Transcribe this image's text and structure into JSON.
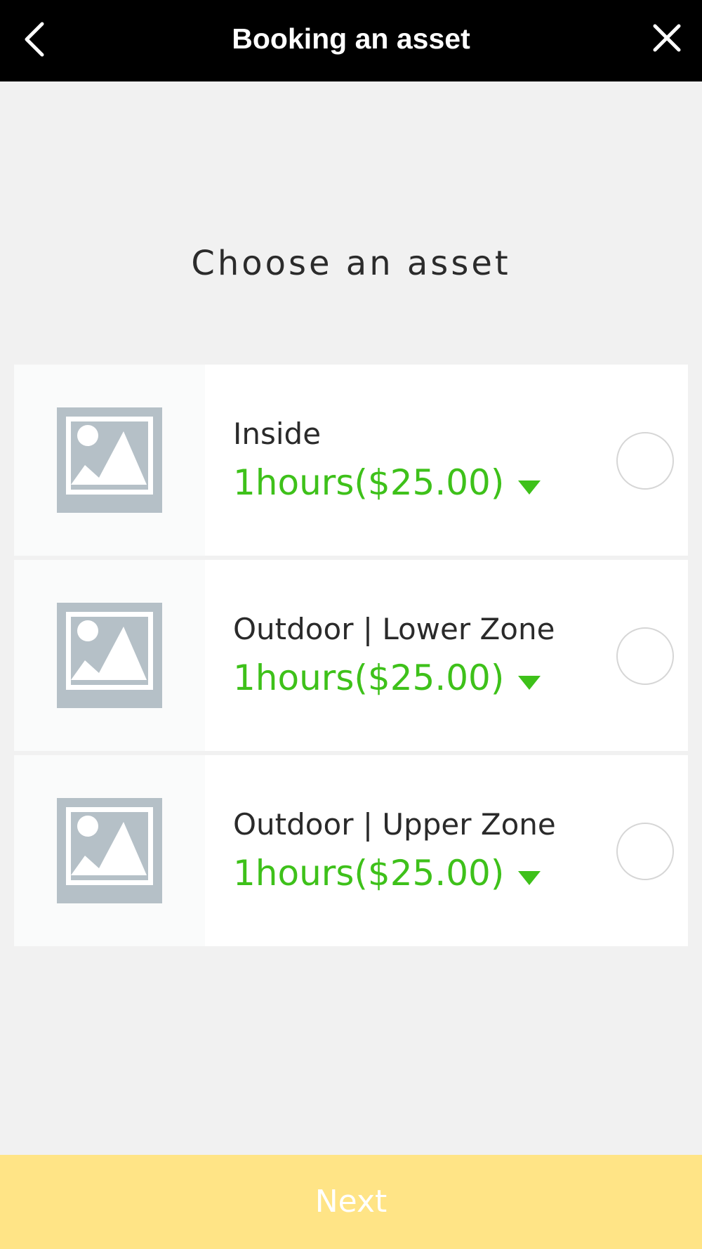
{
  "header": {
    "title": "Booking an asset",
    "back_icon": "chevron-left-icon",
    "close_icon": "close-icon"
  },
  "main": {
    "title": "Choose an asset",
    "assets": [
      {
        "name": "Inside",
        "duration": "1hours($25.00)",
        "selected": false
      },
      {
        "name": "Outdoor | Lower Zone",
        "duration": "1hours($25.00)",
        "selected": false
      },
      {
        "name": "Outdoor | Upper Zone",
        "duration": "1hours($25.00)",
        "selected": false
      }
    ]
  },
  "footer": {
    "next_label": "Next"
  },
  "colors": {
    "header_bg": "#000000",
    "page_bg": "#f1f1f1",
    "accent_green": "#3ec11a",
    "next_button_bg": "#ffe486",
    "placeholder_gray": "#b5c0c7"
  }
}
